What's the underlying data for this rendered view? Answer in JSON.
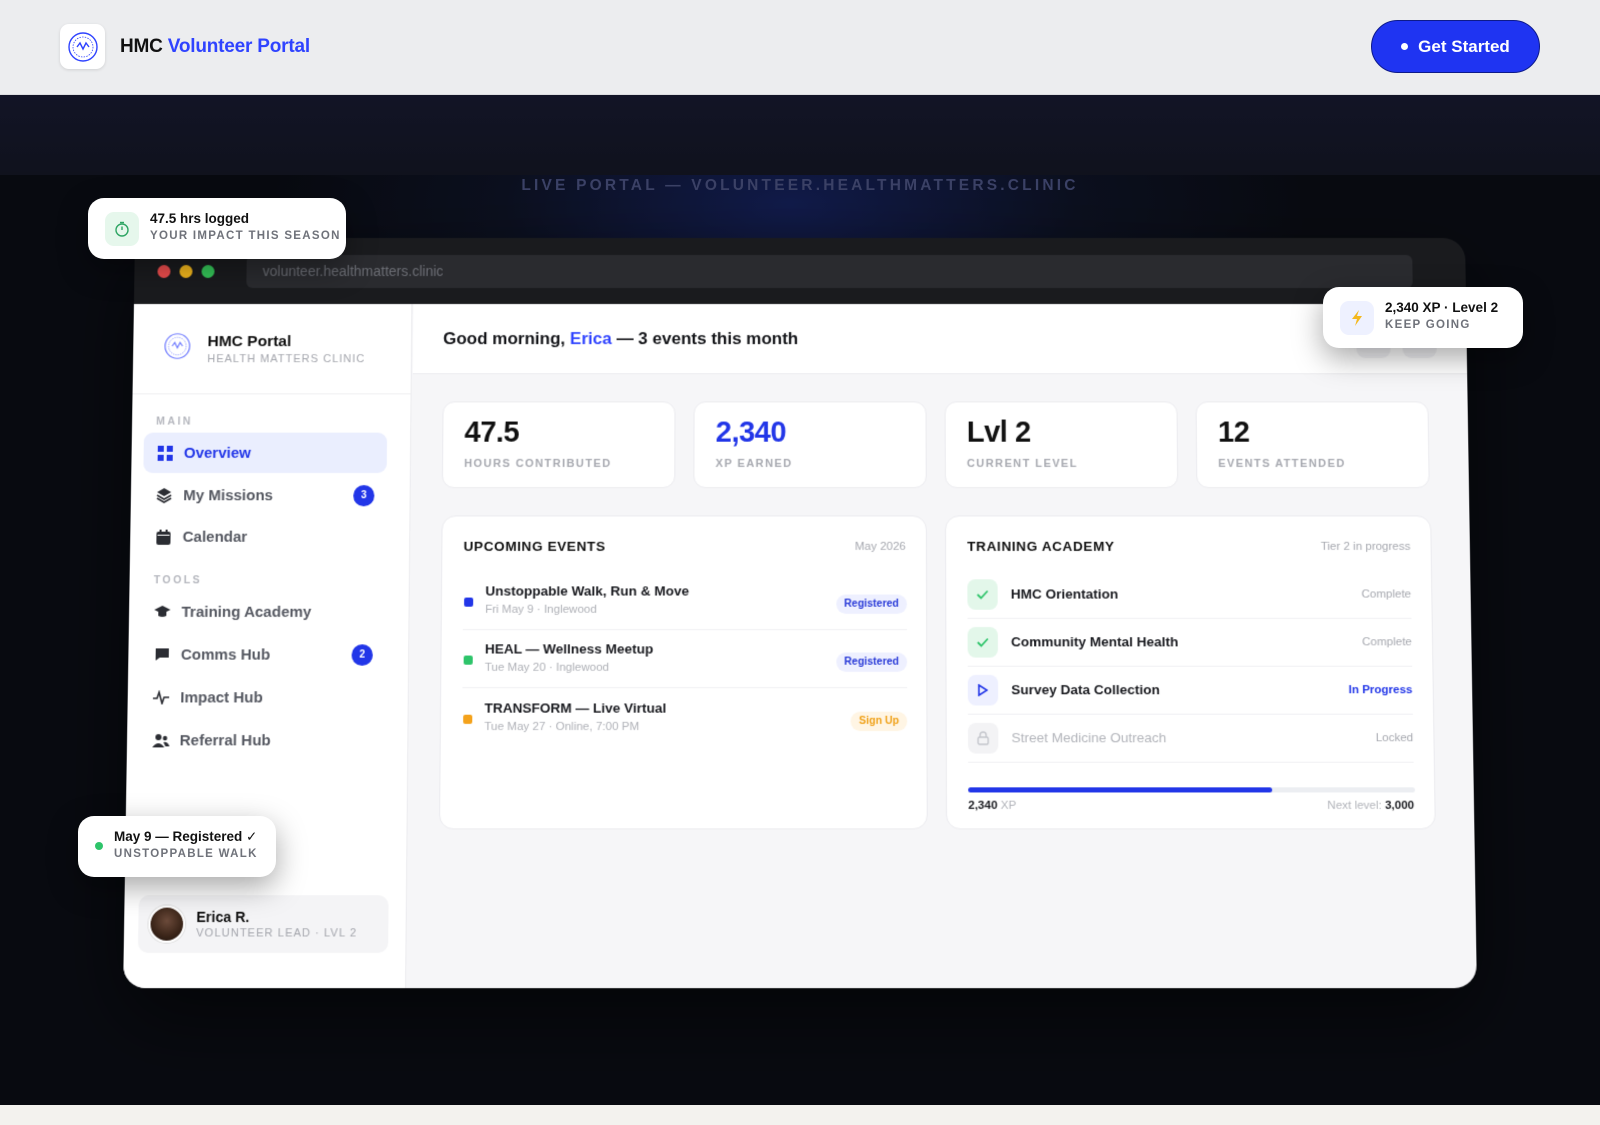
{
  "nav": {
    "brand_prefix": "HMC",
    "brand_highlight": "Volunteer Portal",
    "cta_label": "Get Started"
  },
  "hero": {
    "portal_label": "LIVE PORTAL — VOLUNTEER.HEALTHMATTERS.CLINIC"
  },
  "browser": {
    "url": "volunteer.healthmatters.clinic"
  },
  "sidebar": {
    "title": "HMC Portal",
    "subtitle": "HEALTH MATTERS CLINIC",
    "section_main": "MAIN",
    "section_tools": "TOOLS",
    "items": [
      {
        "label": "Overview",
        "icon": "grid-icon"
      },
      {
        "label": "My Missions",
        "icon": "layers-icon",
        "badge": "3"
      },
      {
        "label": "Calendar",
        "icon": "calendar-icon"
      },
      {
        "label": "Training Academy",
        "icon": "graduation-cap-icon"
      },
      {
        "label": "Comms Hub",
        "icon": "chat-icon",
        "badge": "2"
      },
      {
        "label": "Impact Hub",
        "icon": "activity-icon"
      },
      {
        "label": "Referral Hub",
        "icon": "users-icon"
      }
    ],
    "user": {
      "name": "Erica R.",
      "role": "VOLUNTEER LEAD · LVL 2"
    }
  },
  "header": {
    "greeting_prefix": "Good morning,",
    "greeting_name": "Erica",
    "greeting_suffix": "— 3 events this month"
  },
  "stats": [
    {
      "value": "47.5",
      "label": "HOURS CONTRIBUTED"
    },
    {
      "value": "2,340",
      "label": "XP EARNED"
    },
    {
      "value": "Lvl 2",
      "label": "CURRENT LEVEL"
    },
    {
      "value": "12",
      "label": "EVENTS ATTENDED"
    }
  ],
  "events": {
    "title": "UPCOMING EVENTS",
    "meta": "May 2026",
    "items": [
      {
        "title": "Unstoppable Walk, Run & Move",
        "sub": "Fri May 9 · Inglewood",
        "status": "Registered",
        "color": "#2236e8"
      },
      {
        "title": "HEAL — Wellness Meetup",
        "sub": "Tue May 20 · Inglewood",
        "status": "Registered",
        "color": "#2ec46a"
      },
      {
        "title": "TRANSFORM — Live Virtual",
        "sub": "Tue May 27 · Online, 7:00 PM",
        "status": "Sign Up",
        "color": "#f4a21b"
      }
    ]
  },
  "training": {
    "title": "TRAINING ACADEMY",
    "meta": "Tier 2 in progress",
    "items": [
      {
        "name": "HMC Orientation",
        "status": "Complete"
      },
      {
        "name": "Community Mental Health",
        "status": "Complete"
      },
      {
        "name": "Survey Data Collection",
        "status": "In Progress"
      },
      {
        "name": "Street Medicine Outreach",
        "status": "Locked"
      }
    ],
    "xp_current": "2,340",
    "xp_unit": "XP",
    "next_label": "Next level:",
    "next_value": "3,000",
    "progress_fraction": 0.68
  },
  "floats": {
    "hours": {
      "title": "47.5 hrs logged",
      "sub": "YOUR IMPACT THIS SEASON"
    },
    "xp": {
      "title": "2,340 XP · Level 2",
      "sub": "KEEP GOING"
    },
    "registered": {
      "title": "May 9 — Registered ✓",
      "sub": "UNSTOPPABLE WALK"
    }
  },
  "colors": {
    "accent": "#2236e8",
    "success": "#2ec46a",
    "warning": "#f4a21b"
  }
}
